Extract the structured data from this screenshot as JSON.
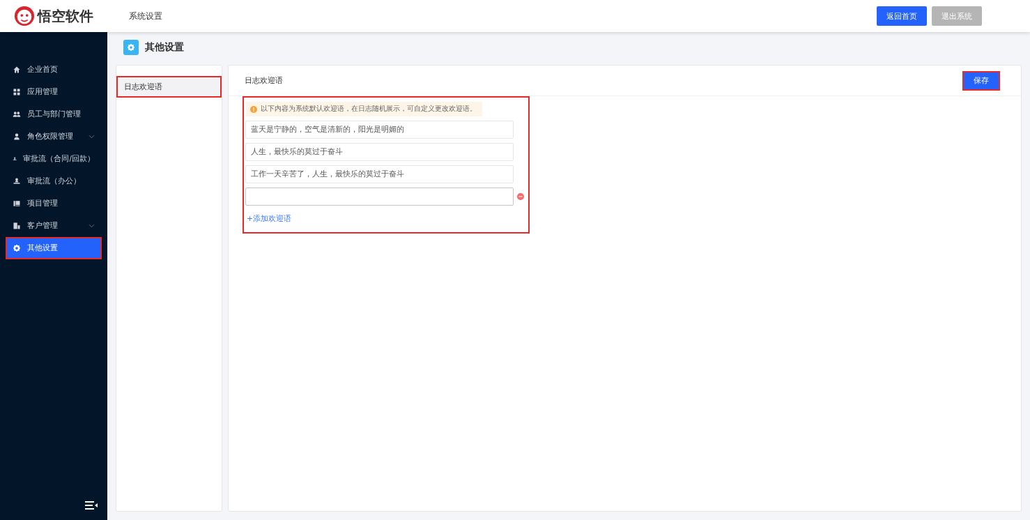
{
  "header": {
    "brand": "悟空软件",
    "section": "系统设置",
    "buttons": [
      {
        "label": "返回首页",
        "kind": "primary"
      },
      {
        "label": "退出系统",
        "kind": "muted"
      }
    ]
  },
  "sidebar": {
    "items": [
      {
        "label": "企业首页",
        "expandable": false,
        "selected": false
      },
      {
        "label": "应用管理",
        "expandable": false,
        "selected": false
      },
      {
        "label": "员工与部门管理",
        "expandable": false,
        "selected": false
      },
      {
        "label": "角色权限管理",
        "expandable": true,
        "selected": false
      },
      {
        "label": "审批流（合同/回款）",
        "expandable": false,
        "selected": false
      },
      {
        "label": "审批流（办公）",
        "expandable": false,
        "selected": false
      },
      {
        "label": "项目管理",
        "expandable": false,
        "selected": false
      },
      {
        "label": "客户管理",
        "expandable": true,
        "selected": false
      },
      {
        "label": "其他设置",
        "expandable": false,
        "selected": true
      }
    ]
  },
  "page": {
    "title": "其他设置"
  },
  "submenu": {
    "items": [
      {
        "label": "日志欢迎语",
        "selected": true
      }
    ]
  },
  "panel": {
    "title": "日志欢迎语",
    "save": "保存",
    "notice": "以下内容为系统默认欢迎语，在日志随机展示，可自定义更改欢迎语。",
    "entries": [
      {
        "value": "蓝天是宁静的，空气是清新的，阳光是明媚的",
        "removable": false
      },
      {
        "value": "人生，最快乐的莫过于奋斗",
        "removable": false
      },
      {
        "value": "工作一天辛苦了，人生，最快乐的莫过于奋斗",
        "removable": false
      },
      {
        "removable": true
      }
    ],
    "add_link": "+添加欢迎语"
  }
}
